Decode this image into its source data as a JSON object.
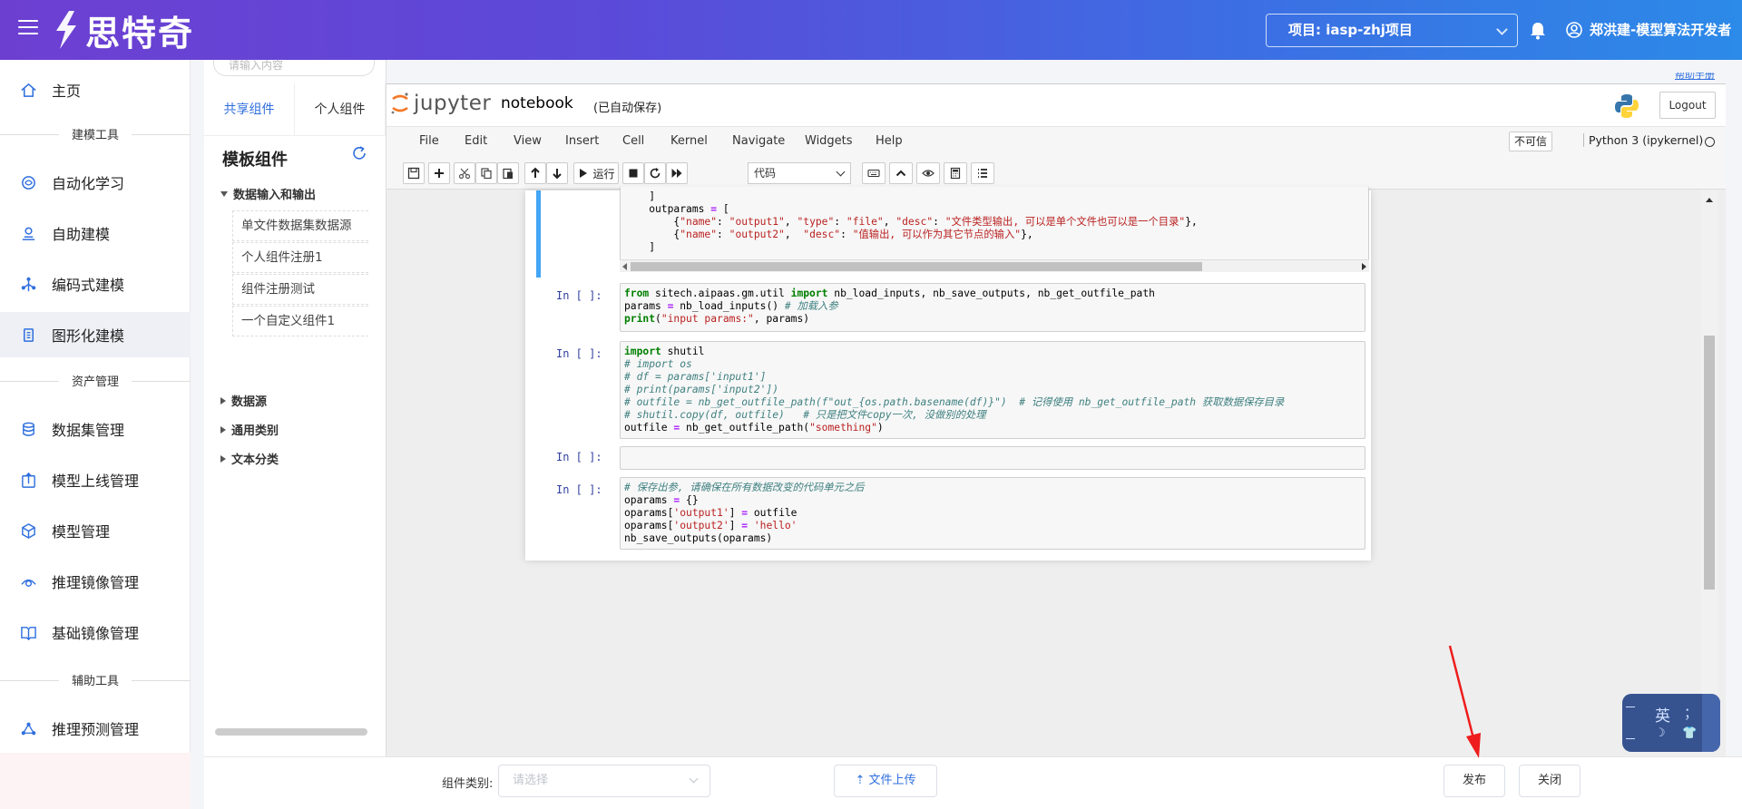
{
  "header": {
    "logo_text": "思特奇",
    "project": "项目: iasp-zhj项目",
    "user": "郑洪建-模型算法开发者"
  },
  "sidebar": {
    "items": [
      {
        "label": "主页",
        "icon": "home-icon"
      },
      {
        "label": "自动化学习",
        "icon": "automl-icon"
      },
      {
        "label": "自助建模",
        "icon": "self-model-icon"
      },
      {
        "label": "编码式建模",
        "icon": "code-model-icon"
      },
      {
        "label": "图形化建模",
        "icon": "graph-model-icon"
      },
      {
        "label": "数据集管理",
        "icon": "database-icon"
      },
      {
        "label": "模型上线管理",
        "icon": "deploy-icon"
      },
      {
        "label": "模型管理",
        "icon": "cube-icon"
      },
      {
        "label": "推理镜像管理",
        "icon": "image-icon"
      },
      {
        "label": "基础镜像管理",
        "icon": "book-icon"
      },
      {
        "label": "推理预测管理",
        "icon": "network-icon"
      }
    ],
    "sections": [
      "建模工具",
      "资产管理",
      "辅助工具"
    ]
  },
  "components": {
    "search_placeholder": "请输入内容",
    "tabs": [
      "共享组件",
      "个人组件"
    ],
    "title": "模板组件",
    "groups": [
      {
        "label": "数据输入和输出",
        "expanded": true,
        "leaves": [
          "单文件数据集数据源",
          "个人组件注册1",
          "组件注册测试",
          "一个自定义组件1"
        ]
      },
      {
        "label": "数据源",
        "expanded": false
      },
      {
        "label": "通用类别",
        "expanded": false
      },
      {
        "label": "文本分类",
        "expanded": false
      }
    ]
  },
  "jupyter": {
    "logo_text": "jupyter",
    "notebook_name": "notebook",
    "save_status": "(已自动保存)",
    "logout": "Logout",
    "menus": [
      "File",
      "Edit",
      "View",
      "Insert",
      "Cell",
      "Kernel",
      "Navigate",
      "Widgets",
      "Help"
    ],
    "trusted": "不可信",
    "kernel": "Python 3 (ipykernel)",
    "run_label": "运行",
    "cell_type": "代码",
    "prompt": "In  [  ]:"
  },
  "bottom": {
    "category_label": "组件类别:",
    "category_placeholder": "请选择",
    "upload_label": "文件上传",
    "publish_label": "发布",
    "close_label": "关闭"
  },
  "help_link": "帮助手册",
  "ime": {
    "lang": "英",
    "punct": "；",
    "moon": "☽",
    "shirt": "👕"
  }
}
